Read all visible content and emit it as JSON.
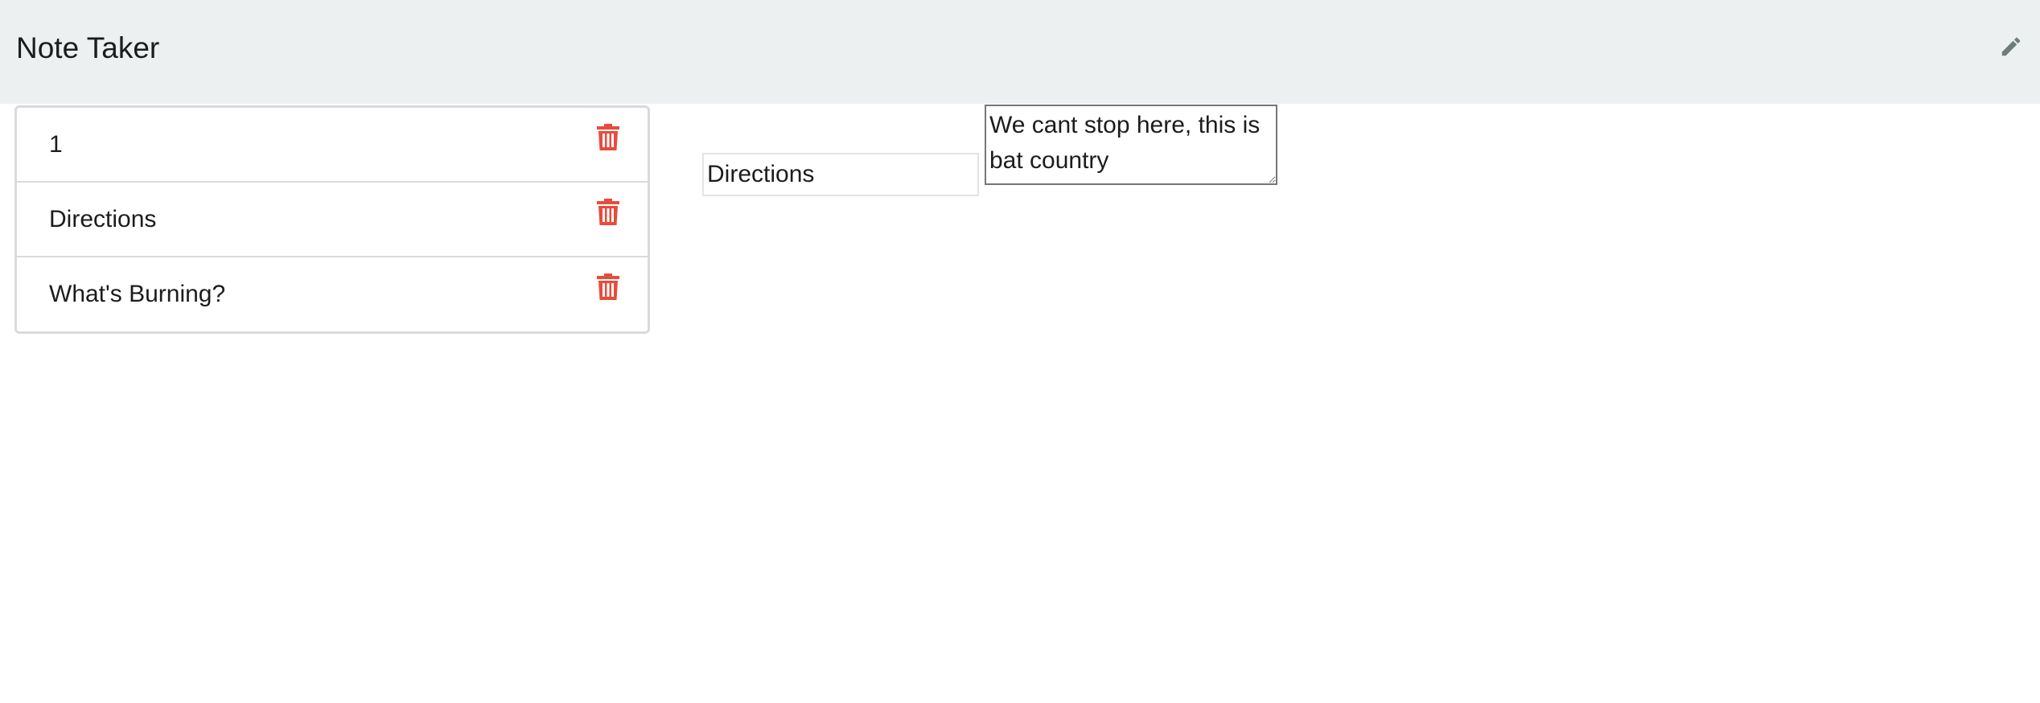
{
  "header": {
    "title": "Note Taker",
    "edit_icon": "pencil-icon"
  },
  "notes": [
    {
      "title": "1",
      "delete_icon": "trash-icon"
    },
    {
      "title": "Directions",
      "delete_icon": "trash-icon"
    },
    {
      "title": "What's Burning?",
      "delete_icon": "trash-icon"
    }
  ],
  "editor": {
    "title_value": "Directions",
    "body_value": "We cant stop here, this is bat country"
  },
  "colors": {
    "header_bg": "#ecf0f1",
    "delete_icon": "#e74c3c",
    "edit_icon": "#707b7c",
    "list_border": "#d9dadb"
  }
}
